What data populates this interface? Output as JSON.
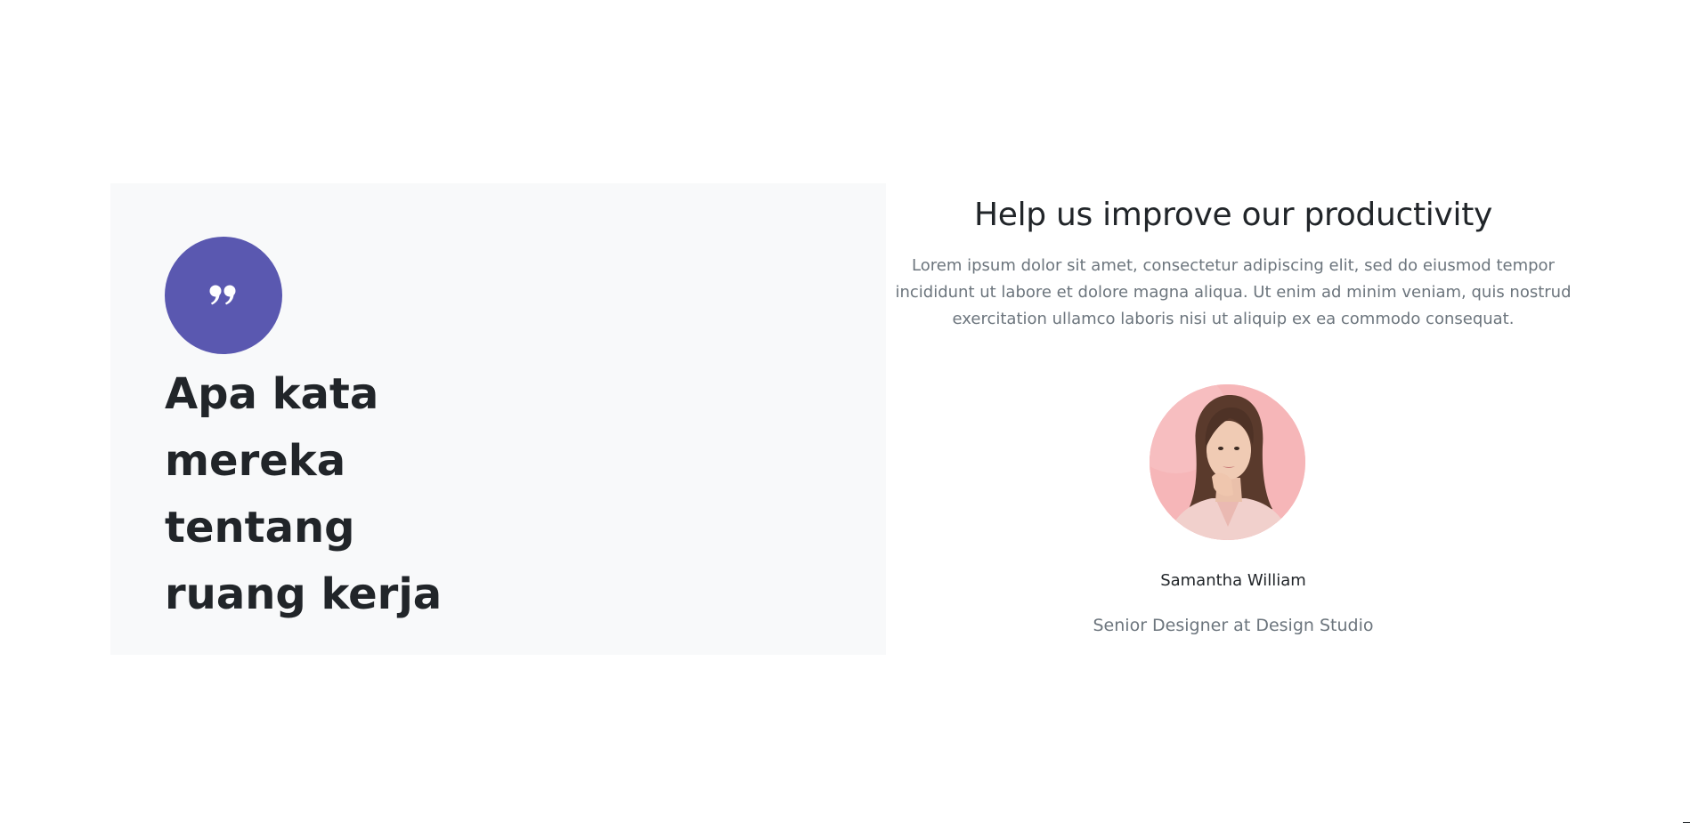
{
  "colors": {
    "accent": "#5a58b0",
    "panel_bg": "#f8f9fa",
    "heading": "#212529",
    "muted": "#6c757d"
  },
  "left_panel": {
    "quote_icon": "quote-icon",
    "heading_lines": [
      "Apa kata",
      "mereka tentang",
      "ruang kerja"
    ]
  },
  "testimonial": {
    "title": "Help us improve our productivity",
    "description": "Lorem ipsum dolor sit amet, consectetur adipiscing elit, sed do eiusmod tempor incididunt ut labore et dolore magna aliqua. Ut enim ad minim veniam, quis nostrud exercitation ullamco laboris nisi ut aliquip ex ea commodo consequat.",
    "avatar_icon": "woman-portrait-avatar",
    "name": "Samantha William",
    "role": "Senior Designer at Design Studio"
  }
}
